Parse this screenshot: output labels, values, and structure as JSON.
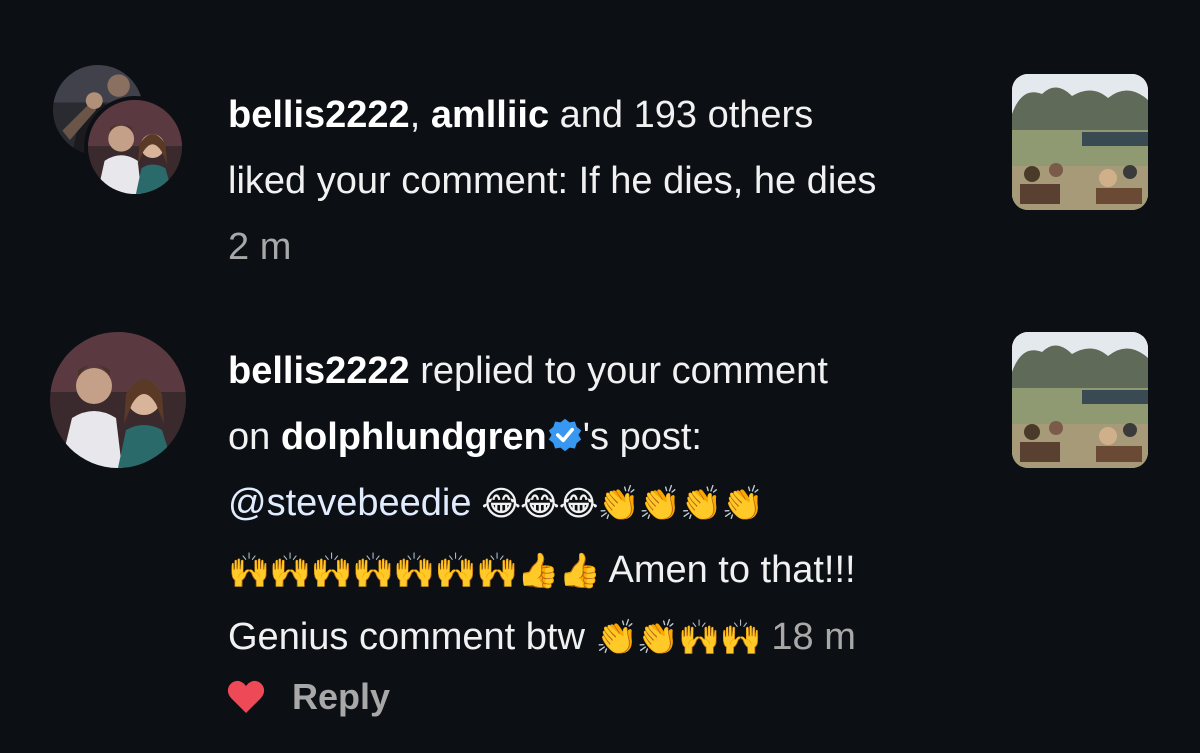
{
  "notifications": [
    {
      "users": [
        "bellis2222",
        "amlliic"
      ],
      "separator": ", ",
      "joiner": " and ",
      "others": "193 others",
      "line2": "liked your comment: If he dies, he dies",
      "time": "2 m",
      "avatar_icons": [
        "user-avatar-back",
        "user-avatar-front"
      ],
      "thumbnail_icon": "park-photo-thumbnail"
    },
    {
      "user": "bellis2222",
      "action": " replied to your comment",
      "on_prefix": "on ",
      "post_owner": "dolphlundgren",
      "post_suffix": "'s post:",
      "mention": "@stevebeedie",
      "emoji_line1": " 😂😂😂👏👏👏👏",
      "emoji_line2": "🙌🙌🙌🙌🙌🙌🙌👍👍",
      "line3_text": " Amen to that!!!",
      "line4_text": "Genius comment btw ",
      "emoji_line4": "👏👏🙌🙌",
      "time": "18 m",
      "reply_label": "Reply",
      "thumbnail_icon": "park-photo-thumbnail"
    }
  ],
  "colors": {
    "background": "#0c0f14",
    "text": "#f1f1f1",
    "muted": "#a8a8a8",
    "mention": "#e1ecff",
    "heart": "#ed4956",
    "verified": "#3897f0"
  }
}
